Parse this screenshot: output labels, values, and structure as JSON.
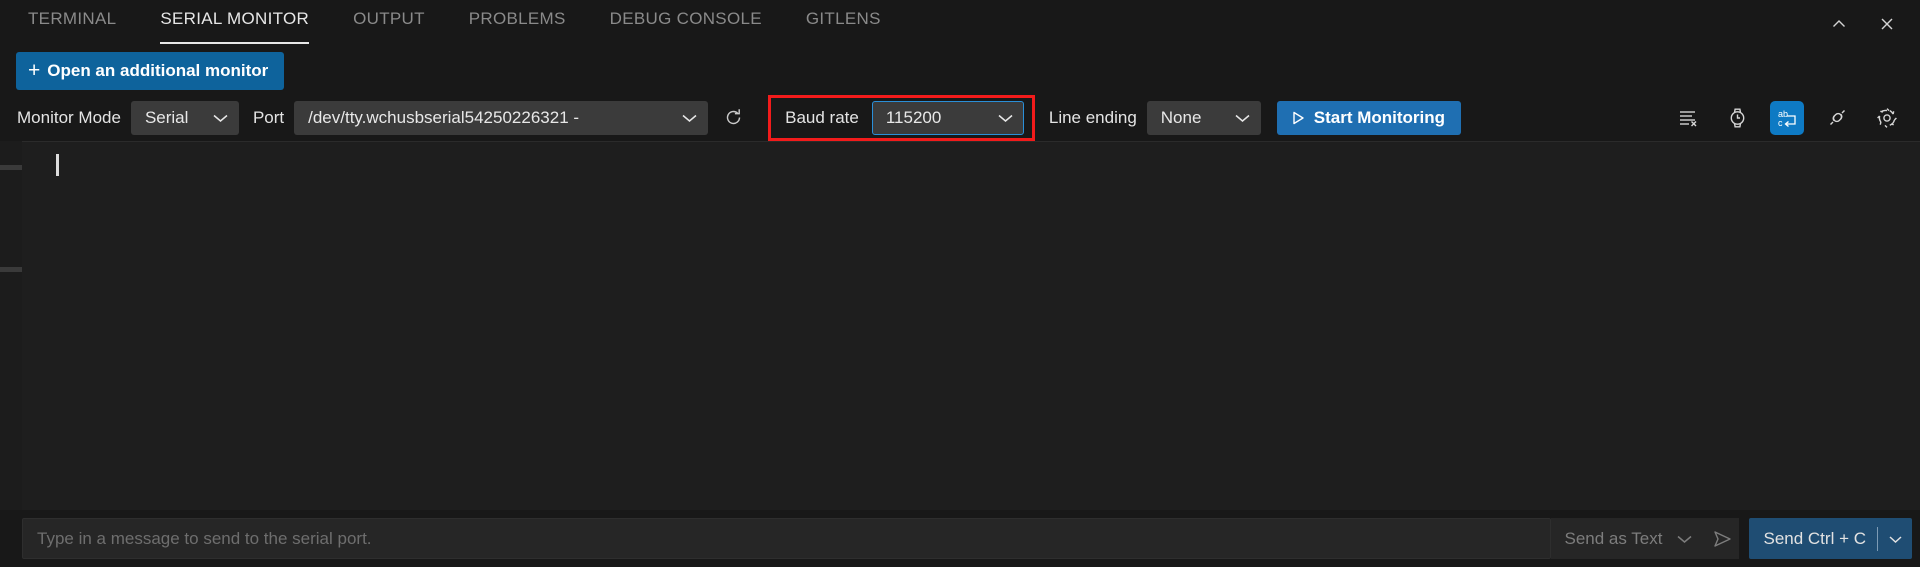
{
  "window": {
    "chevron_up_icon": "chevron-up-icon",
    "close_icon": "close-icon"
  },
  "tabs": [
    {
      "label": "TERMINAL",
      "active": false
    },
    {
      "label": "SERIAL MONITOR",
      "active": true
    },
    {
      "label": "OUTPUT",
      "active": false
    },
    {
      "label": "PROBLEMS",
      "active": false
    },
    {
      "label": "DEBUG CONSOLE",
      "active": false
    },
    {
      "label": "GITLENS",
      "active": false
    }
  ],
  "add_monitor": {
    "label": "Open an additional monitor",
    "plus": "+",
    "background": "#0e639c"
  },
  "toolbar": {
    "monitor_mode_label": "Monitor Mode",
    "monitor_mode_value": "Serial",
    "port_label": "Port",
    "port_value": "/dev/tty.wchusbserial54250226321 -",
    "refresh_icon": "refresh-icon",
    "baud_rate_label": "Baud rate",
    "baud_rate_value": "115200",
    "baud_highlight_color": "#f21b1b",
    "baud_focus_color": "#2a8fd8",
    "line_ending_label": "Line ending",
    "line_ending_value": "None",
    "start_monitoring_label": "Start Monitoring",
    "start_button_color": "#1f6fb2",
    "icons": [
      {
        "name": "clear-output-icon",
        "active": false
      },
      {
        "name": "timestamp-icon",
        "active": false
      },
      {
        "name": "toggle-line-ending-icon",
        "active": true
      },
      {
        "name": "port-connection-icon",
        "active": false
      },
      {
        "name": "settings-gear-icon",
        "active": false
      }
    ],
    "active_icon_color": "#0e7ac4"
  },
  "terminal": {
    "content": "",
    "cursor_visible": true
  },
  "send_bar": {
    "input_value": "",
    "input_placeholder": "Type in a message to send to the serial port.",
    "send_as_label": "Send as Text",
    "send_icon": "send-arrow-icon",
    "ctrl_c_label": "Send Ctrl + C",
    "ctrl_c_color": "#1f4d73"
  }
}
